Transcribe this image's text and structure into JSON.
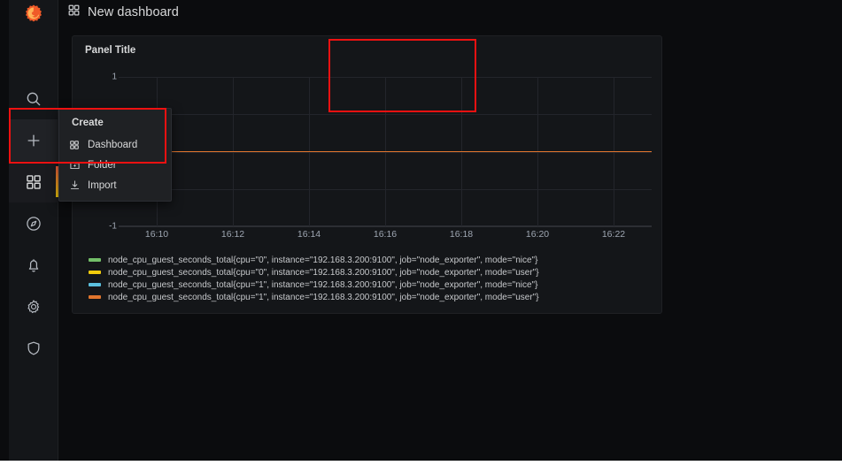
{
  "app": {
    "brand": "grafana-logo",
    "background": "#0b0c0e",
    "panel_bg": "#141619",
    "sidebar_bg": "#141619"
  },
  "topbar": {
    "dashboard_icon": "apps-grid-icon",
    "title": "New dashboard"
  },
  "sidebar": {
    "items": [
      {
        "name": "logo",
        "icon": "grafana-logo-icon",
        "label": ""
      },
      {
        "name": "search",
        "icon": "search-icon",
        "label": ""
      },
      {
        "name": "create",
        "icon": "plus-icon",
        "label": ""
      },
      {
        "name": "dashboards",
        "icon": "apps-grid-icon",
        "label": ""
      },
      {
        "name": "explore",
        "icon": "compass-icon",
        "label": ""
      },
      {
        "name": "alerting",
        "icon": "bell-icon",
        "label": ""
      },
      {
        "name": "configuration",
        "icon": "gear-icon",
        "label": ""
      },
      {
        "name": "server-admin",
        "icon": "shield-icon",
        "label": ""
      }
    ]
  },
  "dropdown": {
    "header": "Create",
    "items": [
      {
        "label": "Dashboard",
        "icon": "apps-grid-icon"
      },
      {
        "label": "Folder",
        "icon": "folder-plus-icon"
      },
      {
        "label": "Import",
        "icon": "import-download-icon"
      }
    ]
  },
  "panel": {
    "title": "Panel Title"
  },
  "annotations": {
    "color": "#ee1111",
    "boxes": [
      {
        "name": "panel-title-highlight"
      },
      {
        "name": "create-dashboard-highlight"
      }
    ]
  },
  "chart_data": {
    "type": "line",
    "title": "Panel Title",
    "xlabel": "",
    "ylabel": "",
    "grid": true,
    "legend_position": "bottom",
    "ylim": [
      -1,
      1
    ],
    "yticks": [
      "1",
      "-1"
    ],
    "ytick_values": [
      1,
      -1
    ],
    "x": [
      "16:10",
      "16:12",
      "16:14",
      "16:16",
      "16:18",
      "16:20",
      "16:22"
    ],
    "xticks": [
      "16:10",
      "16:12",
      "16:14",
      "16:16",
      "16:18",
      "16:20",
      "16:22"
    ],
    "series": [
      {
        "name": "node_cpu_guest_seconds_total{cpu=\"0\", instance=\"192.168.3.200:9100\", job=\"node_exporter\", mode=\"nice\"}",
        "color": "#73BF69",
        "values": [
          0,
          0,
          0,
          0,
          0,
          0,
          0
        ]
      },
      {
        "name": "node_cpu_guest_seconds_total{cpu=\"0\", instance=\"192.168.3.200:9100\", job=\"node_exporter\", mode=\"user\"}",
        "color": "#F2CC0C",
        "values": [
          0,
          0,
          0,
          0,
          0,
          0,
          0
        ]
      },
      {
        "name": "node_cpu_guest_seconds_total{cpu=\"1\", instance=\"192.168.3.200:9100\", job=\"node_exporter\", mode=\"nice\"}",
        "color": "#5BC0DE",
        "values": [
          0,
          0,
          0,
          0,
          0,
          0,
          0
        ]
      },
      {
        "name": "node_cpu_guest_seconds_total{cpu=\"1\", instance=\"192.168.3.200:9100\", job=\"node_exporter\", mode=\"user\"}",
        "color": "#E0752D",
        "values": [
          0,
          0,
          0,
          0,
          0,
          0,
          0
        ]
      }
    ]
  }
}
